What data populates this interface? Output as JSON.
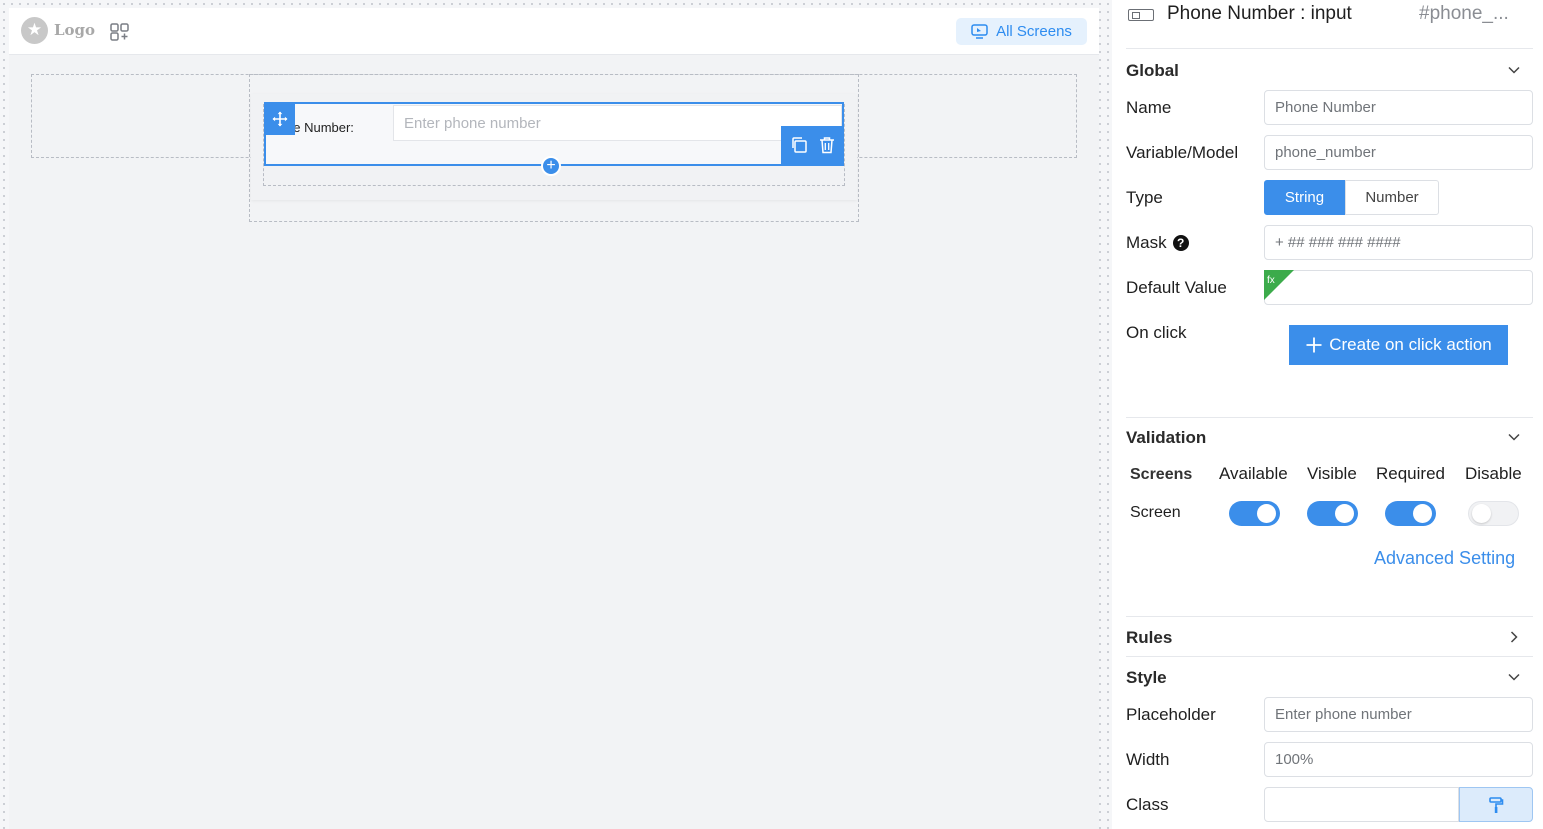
{
  "canvas": {
    "logo_text": "Logo",
    "all_screens_label": "All Screens",
    "field": {
      "label": "ne Number:",
      "placeholder": "Enter phone number"
    }
  },
  "panel": {
    "title": "Phone Number : input",
    "id": "#phone_...",
    "global": {
      "title": "Global",
      "name_label": "Name",
      "name_value": "Phone Number",
      "variable_label": "Variable/Model",
      "variable_value": "phone_number",
      "type_label": "Type",
      "type_options": [
        "String",
        "Number"
      ],
      "type_selected": "String",
      "mask_label": "Mask",
      "mask_value": "+ ## ### ### ####",
      "default_label": "Default Value",
      "default_value": "",
      "fx_label": "fx",
      "onclick_label": "On click",
      "create_action_label": "Create on click action"
    },
    "validation": {
      "title": "Validation",
      "columns": [
        "Screens",
        "Available",
        "Visible",
        "Required",
        "Disable"
      ],
      "row_label": "Screen",
      "toggles": {
        "available": true,
        "visible": true,
        "required": true,
        "disable": false
      },
      "advanced_label": "Advanced Setting"
    },
    "rules": {
      "title": "Rules"
    },
    "style": {
      "title": "Style",
      "placeholder_label": "Placeholder",
      "placeholder_value": "Enter phone number",
      "width_label": "Width",
      "width_value": "100%",
      "class_label": "Class",
      "class_value": ""
    }
  },
  "colors": {
    "accent": "#3b8eea",
    "fx_badge": "#3cab4b",
    "canvas_bg": "#f2f3f5"
  }
}
